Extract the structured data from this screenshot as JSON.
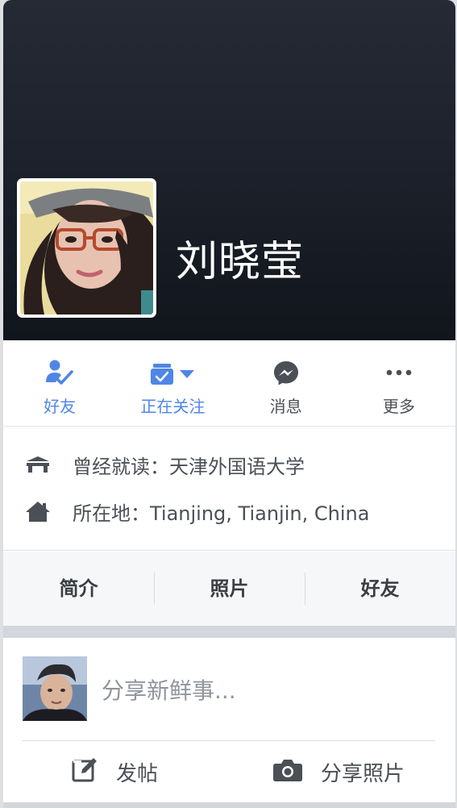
{
  "profile": {
    "name": "刘晓莹"
  },
  "actions": [
    {
      "label": "好友",
      "icon": "friends-check-icon",
      "active": true
    },
    {
      "label": "正在关注",
      "icon": "following-icon",
      "active": true
    },
    {
      "label": "消息",
      "icon": "messenger-icon",
      "active": false
    },
    {
      "label": "更多",
      "icon": "more-dots-icon",
      "active": false
    }
  ],
  "info": {
    "education": "曾经就读：天津外国语大学",
    "location": "所在地：Tianjing, Tianjin, China"
  },
  "tabs": [
    "简介",
    "照片",
    "好友"
  ],
  "composer": {
    "placeholder": "分享新鲜事...",
    "post_label": "发帖",
    "photo_label": "分享照片"
  },
  "colors": {
    "accent": "#4f86e6",
    "text": "#4b4f56",
    "cover_top": "#252a35",
    "cover_bottom": "#11151c"
  }
}
